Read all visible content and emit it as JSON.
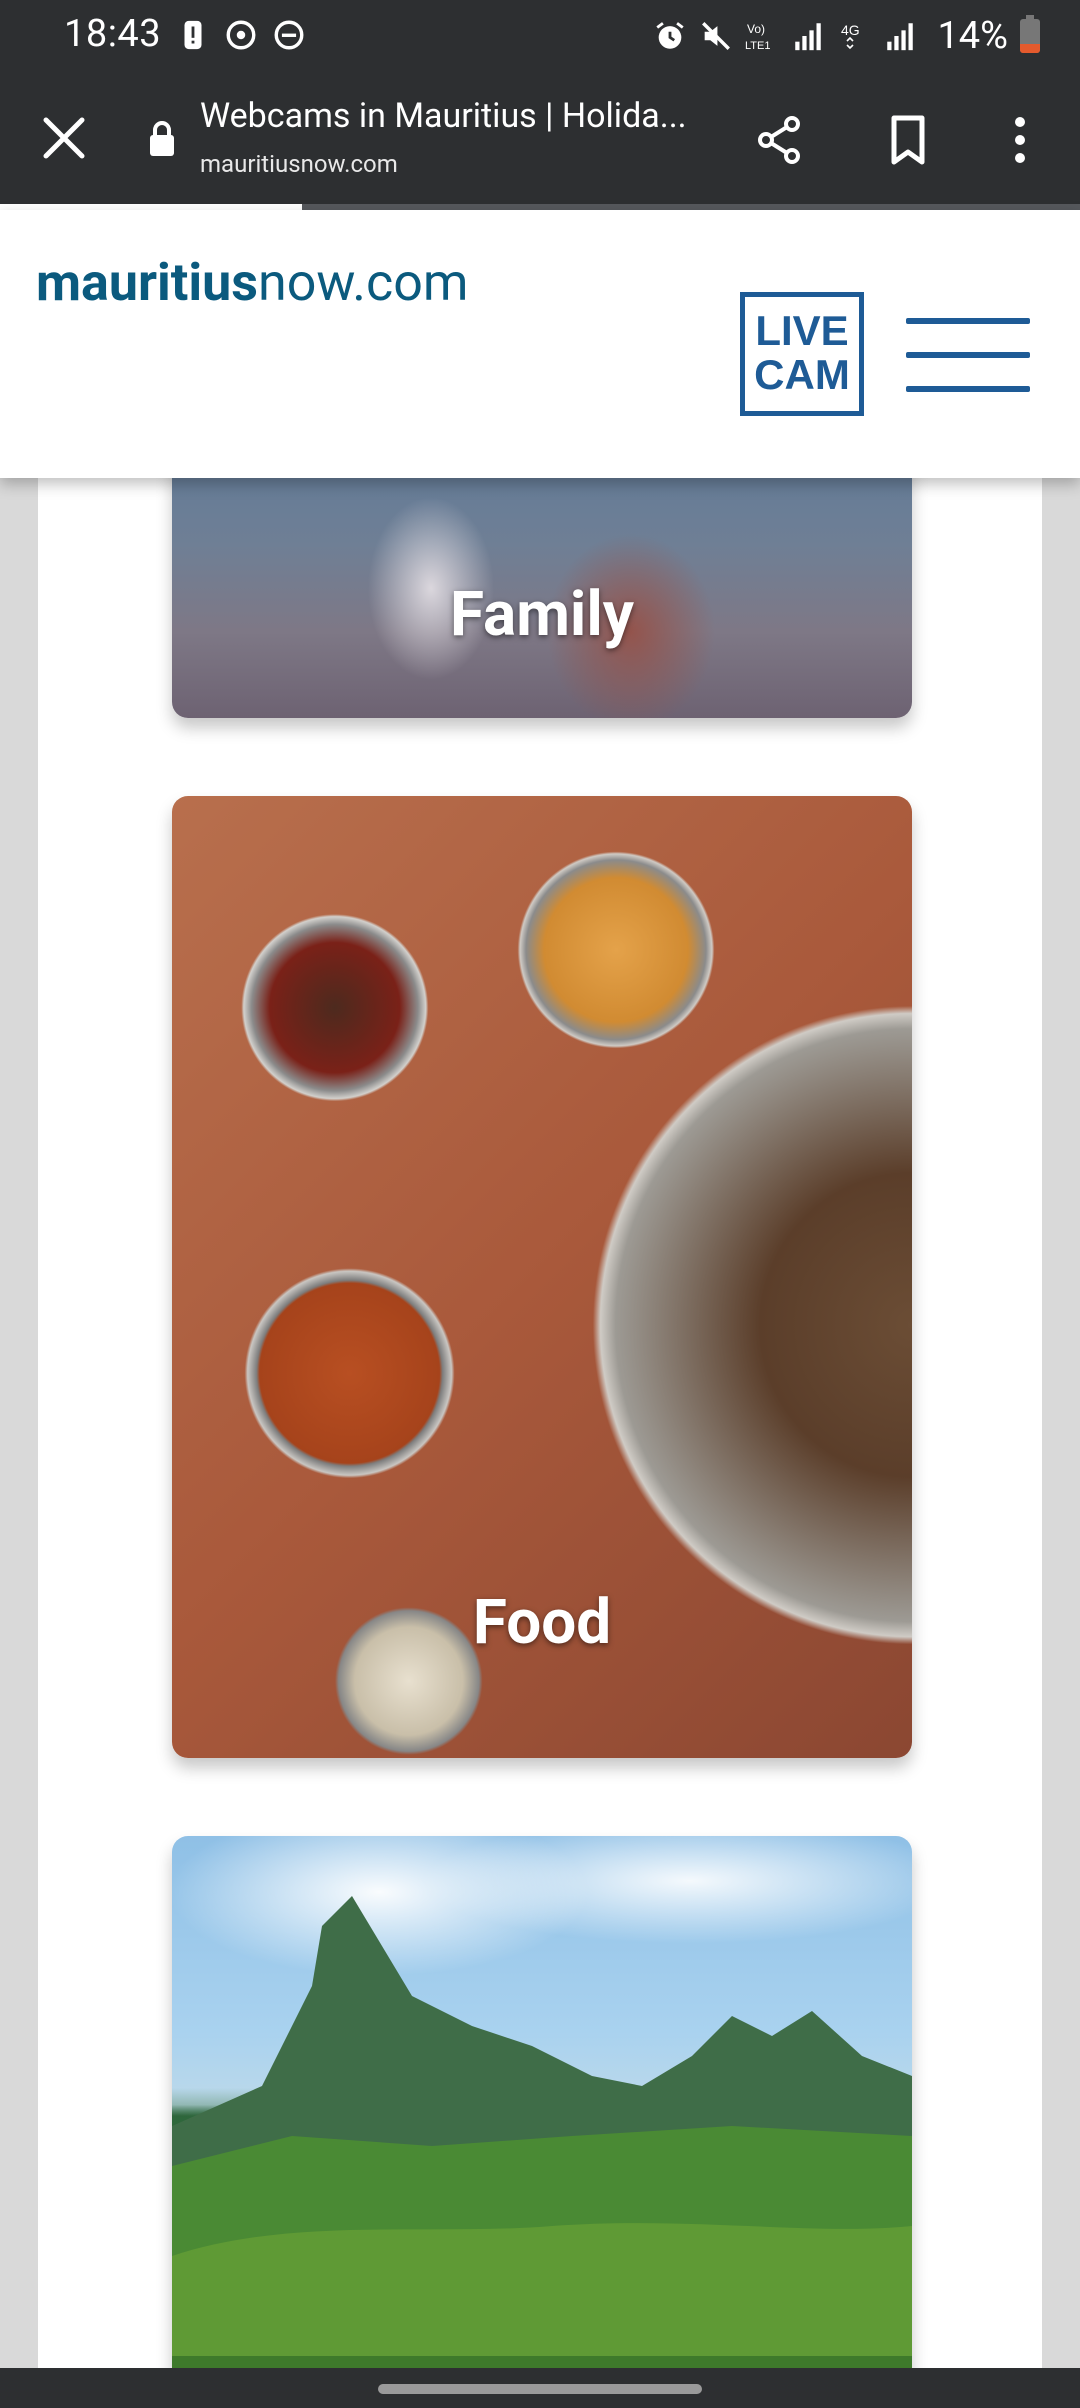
{
  "status_bar": {
    "time": "18:43",
    "battery_percent": "14%",
    "icons_left": [
      "alert-icon",
      "sync-icon",
      "do-not-disturb-icon"
    ],
    "icons_right": [
      "alarm-icon",
      "mute-icon",
      "volte-icon",
      "signal-icon",
      "4g-icon",
      "signal-icon"
    ]
  },
  "toolbar": {
    "title": "Webcams in Mauritius | Holida...",
    "url": "mauritiusnow.com",
    "page_load_progress": 0.28
  },
  "site": {
    "logo_bold": "mauritius",
    "logo_regular": "now.com",
    "livecam_line1": "LIVE",
    "livecam_line2": "CAM",
    "brand_color": "#0b5a7e",
    "accent_color": "#1e5b96"
  },
  "cards": [
    {
      "label": "Family"
    },
    {
      "label": "Food"
    },
    {
      "label": ""
    }
  ]
}
